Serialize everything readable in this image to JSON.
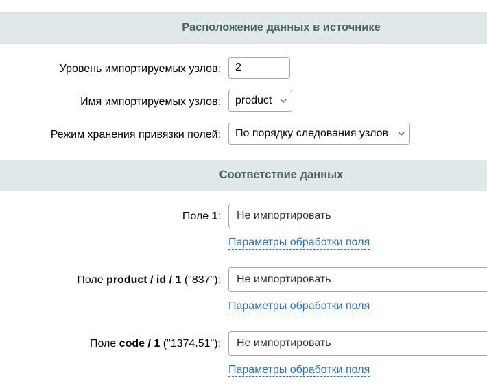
{
  "section_location": {
    "title": "Расположение данных в источнике"
  },
  "level": {
    "label": "Уровень импортируемых узлов:",
    "value": "2"
  },
  "node_name": {
    "label": "Имя импортируемых узлов:",
    "value": "product"
  },
  "storage_mode": {
    "label": "Режим хранения привязки полей:",
    "value": "По порядку следования узлов"
  },
  "section_mapping": {
    "title": "Соответствие данных"
  },
  "fields": [
    {
      "prefix": "Поле ",
      "name": "1",
      "suffix": ":",
      "value": "Не импортировать",
      "link": "Параметры обработки поля"
    },
    {
      "prefix": "Поле ",
      "name": "product / id / 1",
      "suffix": " (\"837\"):",
      "value": "Не импортировать",
      "link": "Параметры обработки поля"
    },
    {
      "prefix": "Поле ",
      "name": "code / 1",
      "suffix": " (\"1374.51\"):",
      "value": "Не импортировать",
      "link": "Параметры обработки поля"
    }
  ],
  "colors": {
    "section_bg": "#e0e8ea",
    "section_text": "#4b6267",
    "link": "#2a6fb5"
  },
  "icons": {
    "select": "chevron-down-icon"
  }
}
